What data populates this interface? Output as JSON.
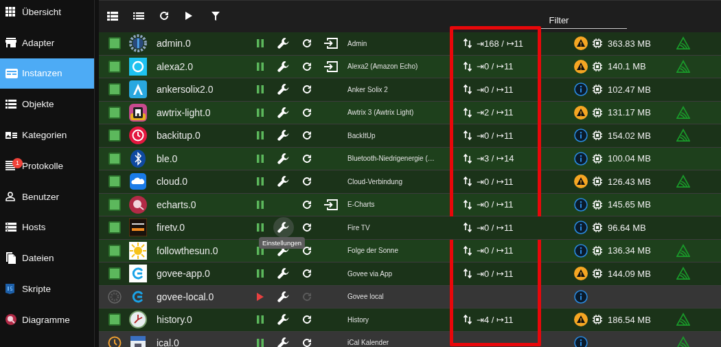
{
  "sidebar": {
    "items": [
      {
        "label": "Übersicht",
        "selected": false
      },
      {
        "label": "Adapter",
        "selected": false
      },
      {
        "label": "Instanzen",
        "selected": true
      },
      {
        "label": "Objekte",
        "selected": false
      },
      {
        "label": "Kategorien",
        "selected": false
      },
      {
        "label": "Protokolle",
        "selected": false,
        "badge": "1"
      },
      {
        "label": "Benutzer",
        "selected": false
      },
      {
        "label": "Hosts",
        "selected": false
      },
      {
        "label": "Dateien",
        "selected": false
      },
      {
        "label": "Skripte",
        "selected": false
      },
      {
        "label": "Diagramme",
        "selected": false
      }
    ]
  },
  "filter": {
    "label": "Filter"
  },
  "instances": [
    {
      "name": "admin.0",
      "title": "Admin",
      "kind": "running",
      "enabled": true,
      "config": true,
      "restart_enabled": true,
      "link": true,
      "io": "⇥168 / ↦11",
      "warning": true,
      "memory": "363.83 MB",
      "sentry": true
    },
    {
      "name": "alexa2.0",
      "title": "Alexa2 (Amazon Echo)",
      "kind": "running",
      "enabled": true,
      "config": true,
      "restart_enabled": true,
      "link": true,
      "io": "⇥0 / ↦11",
      "warning": true,
      "memory": "140.1 MB",
      "sentry": true
    },
    {
      "name": "ankersolix2.0",
      "title": "Anker Solix 2",
      "kind": "running",
      "enabled": true,
      "config": true,
      "restart_enabled": true,
      "link": false,
      "io": "⇥0 / ↦11",
      "warning": false,
      "memory": "102.47 MB",
      "sentry": false
    },
    {
      "name": "awtrix-light.0",
      "title": "Awtrix 3 (Awtrix Light)",
      "kind": "running",
      "enabled": true,
      "config": true,
      "restart_enabled": true,
      "link": false,
      "io": "⇥2 / ↦11",
      "warning": true,
      "memory": "131.17 MB",
      "sentry": true
    },
    {
      "name": "backitup.0",
      "title": "BackItUp",
      "kind": "running",
      "enabled": true,
      "config": true,
      "restart_enabled": true,
      "link": false,
      "io": "⇥0 / ↦11",
      "warning": false,
      "memory": "154.02 MB",
      "sentry": true
    },
    {
      "name": "ble.0",
      "title": "Bluetooth-Niedrigenergie (…",
      "kind": "running",
      "enabled": true,
      "config": true,
      "restart_enabled": true,
      "link": false,
      "io": "⇥3 / ↦14",
      "warning": false,
      "memory": "100.04 MB",
      "sentry": false
    },
    {
      "name": "cloud.0",
      "title": "Cloud-Verbindung",
      "kind": "running",
      "enabled": true,
      "config": true,
      "restart_enabled": true,
      "link": false,
      "io": "⇥0 / ↦11",
      "warning": true,
      "memory": "126.43 MB",
      "sentry": true
    },
    {
      "name": "echarts.0",
      "title": "E-Charts",
      "kind": "running",
      "enabled": true,
      "config": false,
      "restart_enabled": true,
      "link": true,
      "io": "⇥0 / ↦11",
      "warning": false,
      "memory": "145.65 MB",
      "sentry": false
    },
    {
      "name": "firetv.0",
      "title": "Fire TV",
      "kind": "running",
      "enabled": true,
      "config": true,
      "restart_enabled": true,
      "link": false,
      "io": "⇥0 / ↦11",
      "warning": false,
      "memory": "96.64 MB",
      "sentry": false,
      "tooltip": "Einstellungen"
    },
    {
      "name": "followthesun.0",
      "title": "Folge der Sonne",
      "kind": "running",
      "enabled": true,
      "config": true,
      "restart_enabled": true,
      "link": false,
      "io": "⇥0 / ↦11",
      "warning": false,
      "memory": "136.34 MB",
      "sentry": true
    },
    {
      "name": "govee-app.0",
      "title": "Govee via App",
      "kind": "running",
      "enabled": true,
      "config": true,
      "restart_enabled": true,
      "link": false,
      "io": "⇥0 / ↦11",
      "warning": true,
      "memory": "144.09 MB",
      "sentry": true
    },
    {
      "name": "govee-local.0",
      "title": "Govee local",
      "kind": "stopped",
      "enabled": false,
      "config": true,
      "restart_enabled": false,
      "link": false,
      "warning": false,
      "sentry": false
    },
    {
      "name": "history.0",
      "title": "History",
      "kind": "running",
      "enabled": true,
      "config": true,
      "restart_enabled": true,
      "link": false,
      "io": "⇥4 / ↦11",
      "warning": true,
      "memory": "186.54 MB",
      "sentry": true
    },
    {
      "name": "ical.0",
      "title": "iCal Kalender",
      "kind": "scheduled",
      "enabled": true,
      "config": true,
      "restart_enabled": true,
      "link": false,
      "warning": false,
      "sentry": true
    }
  ]
}
